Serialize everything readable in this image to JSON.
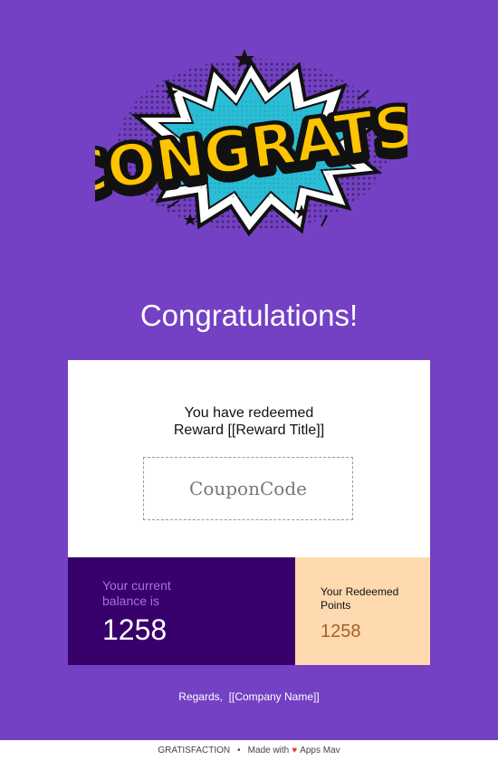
{
  "hero": {
    "logo_text": "CONGRATS!",
    "colors": {
      "burst": "#2bbdd6",
      "text": "#ffc400",
      "outline": "#111111"
    }
  },
  "heading": "Congratulations!",
  "card": {
    "line1": "You have redeemed",
    "line2": "Reward [[Reward Title]]",
    "coupon_code": "CouponCode"
  },
  "balance": {
    "label": "Your current balance is",
    "value": "1258"
  },
  "points": {
    "label": "Your Redeemed Points",
    "value": "1258"
  },
  "regards": "Regards,  [[Company Name]]",
  "footer": {
    "brand": "GRATISFACTION",
    "made_with": "Made with",
    "heart_icon": "heart-icon",
    "vendor": "Apps Mav"
  },
  "colors": {
    "background": "#7440c4",
    "balance_bg": "#38006b",
    "points_bg": "#ffd9b0",
    "card_bg": "#ffffff"
  }
}
